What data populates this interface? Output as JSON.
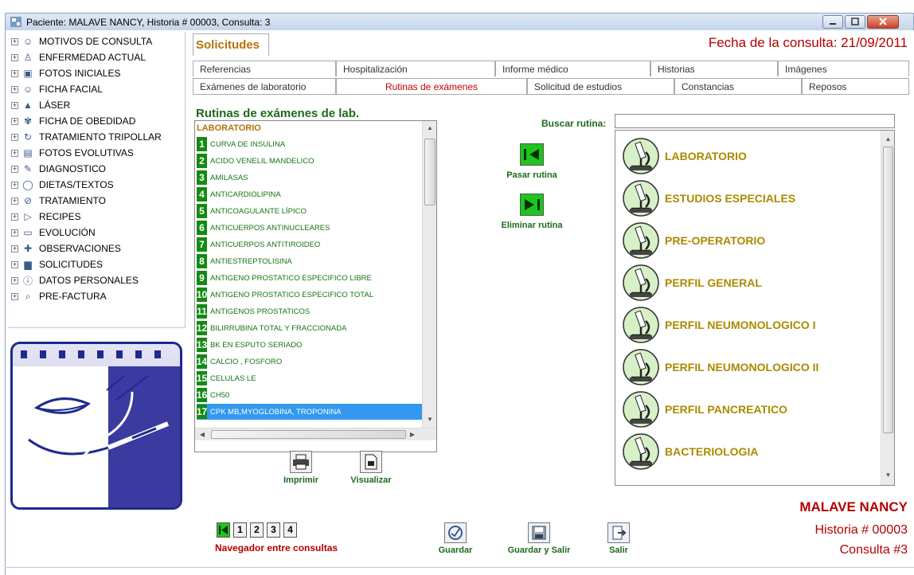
{
  "window": {
    "title": "Paciente: MALAVE  NANCY, Historia # 00003, Consulta: 3"
  },
  "tree": {
    "items": [
      {
        "label": "MOTIVOS DE CONSULTA",
        "icon": "person-icon"
      },
      {
        "label": "ENFERMEDAD ACTUAL",
        "icon": "patient-icon"
      },
      {
        "label": "FOTOS INICIALES",
        "icon": "photo-icon"
      },
      {
        "label": "FICHA FACIAL",
        "icon": "face-icon"
      },
      {
        "label": "LÁSER",
        "icon": "laser-icon"
      },
      {
        "label": "FICHA DE OBEDIDAD",
        "icon": "scale-icon"
      },
      {
        "label": "TRATAMIENTO TRIPOLLAR",
        "icon": "cycle-icon"
      },
      {
        "label": "FOTOS EVOLUTIVAS",
        "icon": "photos-icon"
      },
      {
        "label": "DIAGNOSTICO",
        "icon": "pencil-icon"
      },
      {
        "label": "DIETAS/TEXTOS",
        "icon": "apple-icon"
      },
      {
        "label": "TRATAMIENTO",
        "icon": "check-icon"
      },
      {
        "label": "RECIPES",
        "icon": "recipe-icon"
      },
      {
        "label": "EVOLUCIÓN",
        "icon": "evolution-icon"
      },
      {
        "label": "OBSERVACIONES",
        "icon": "observations-icon"
      },
      {
        "label": "SOLICITUDES",
        "icon": "requests-icon"
      },
      {
        "label": "DATOS PERSONALES",
        "icon": "info-icon"
      },
      {
        "label": "PRE-FACTURA",
        "icon": "invoice-icon"
      }
    ]
  },
  "header": {
    "main_tab": "Solicitudes",
    "fecha_label": "Fecha de la consulta:  21/09/2011"
  },
  "tabs_row1": [
    "Referencias",
    "Hospitalización",
    "Informe médico",
    "Historias",
    "Imágenes"
  ],
  "tabs_row2": [
    "Exámenes de laboratorio",
    "Rutinas de exámenes",
    "Solicitud de estudios",
    "Constancias",
    "Reposos"
  ],
  "active_tab": "Rutinas de exámenes",
  "list": {
    "title": "Rutinas de exámenes de lab.",
    "group": "LABORATORIO",
    "items": [
      {
        "n": "1",
        "label": "CURVA DE INSULINA"
      },
      {
        "n": "2",
        "label": "ACIDO VENELIL MANDELICO"
      },
      {
        "n": "3",
        "label": "AMILASAS"
      },
      {
        "n": "4",
        "label": "ANTICARDIOLIPINA"
      },
      {
        "n": "5",
        "label": "ANTICOAGULANTE LÍPICO"
      },
      {
        "n": "6",
        "label": "ANTICUERPOS ANTINUCLEARES"
      },
      {
        "n": "7",
        "label": "ANTICUERPOS ANTITIROIDEO"
      },
      {
        "n": "8",
        "label": "ANTIESTREPTOLISINA"
      },
      {
        "n": "9",
        "label": "ANTIGENO PROSTATICO ESPECIFICO LIBRE"
      },
      {
        "n": "10",
        "label": "ANTIGENO PROSTATICO ESPECIFICO TOTAL"
      },
      {
        "n": "11",
        "label": "ANTIGENOS PROSTATICOS"
      },
      {
        "n": "12",
        "label": "BILIRRUBINA TOTAL Y FRACCIONADA"
      },
      {
        "n": "13",
        "label": "BK EN ESPUTO SERIADO"
      },
      {
        "n": "14",
        "label": "CALCIO ,  FOSFORO"
      },
      {
        "n": "15",
        "label": "CELULAS LE"
      },
      {
        "n": "16",
        "label": "CH50"
      },
      {
        "n": "17",
        "label": "CPK MB,MYOGLOBINA, TROPONINA"
      }
    ],
    "selected_index": 16
  },
  "actions": {
    "imprimir": "Imprimir",
    "visualizar": "Visualizar",
    "pasar": "Pasar rutina",
    "eliminar": "Eliminar rutina",
    "buscar_label": "Buscar rutina:",
    "buscar_value": ""
  },
  "rutinas": [
    "LABORATORIO",
    "ESTUDIOS ESPECIALES",
    "PRE-OPERATORIO",
    "PERFIL GENERAL",
    "PERFIL NEUMONOLOGICO I",
    "PERFIL NEUMONOLOGICO II",
    "PERFIL PANCREATICO",
    "BACTERIOLOGIA"
  ],
  "footer": {
    "nav_pages": [
      "1",
      "2",
      "3",
      "4"
    ],
    "nav_label": "Navegador entre consultas",
    "guardar": "Guardar",
    "guardar_salir": "Guardar y Salir",
    "salir": "Salir",
    "nombre": "MALAVE NANCY",
    "historia": "Historia # 00003",
    "consulta": "Consulta #3"
  },
  "colors": {
    "accent_red": "#b40000",
    "label_green": "#1d6a1d",
    "gold": "#aa8a00",
    "tab_orange": "#b6720a",
    "selection_blue": "#3399ee"
  }
}
